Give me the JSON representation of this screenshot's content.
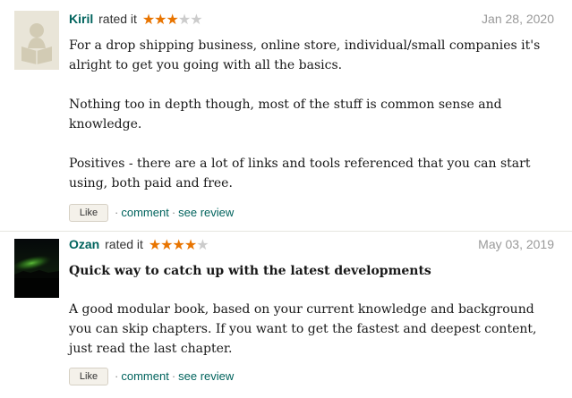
{
  "colors": {
    "star_filled": "#e87400",
    "star_empty": "#cccccc",
    "username": "#00635d",
    "link": "#00635d",
    "date": "#999999"
  },
  "reviews": [
    {
      "user": "Kiril",
      "rated_text": "rated it",
      "rating": 3,
      "max_rating": 5,
      "date": "Jan 28, 2020",
      "title": "",
      "paragraphs": [
        "For a drop shipping business, online store, individual/small companies it's alright to get you going with all the basics.",
        "Nothing too in depth though, most of the stuff is common sense and knowledge.",
        "Positives - there are a lot of links and tools referenced that you can start using, both paid and free."
      ],
      "avatar_icon": "default-reader-avatar-icon",
      "like_label": "Like",
      "comment_label": "comment",
      "see_review_label": "see review"
    },
    {
      "user": "Ozan",
      "rated_text": "rated it",
      "rating": 4,
      "max_rating": 5,
      "date": "May 03, 2019",
      "title": "Quick way to catch up with the latest developments",
      "paragraphs": [
        "A good modular book, based on your current knowledge and background you can skip chapters. If you want to get the fastest and deepest content, just read the last chapter."
      ],
      "avatar_icon": "aurora-photo-avatar",
      "like_label": "Like",
      "comment_label": "comment",
      "see_review_label": "see review"
    }
  ]
}
